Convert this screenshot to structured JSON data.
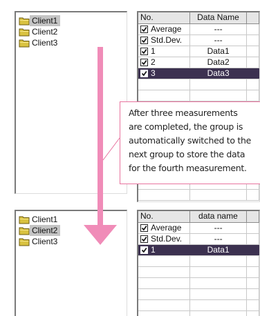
{
  "top": {
    "tree": [
      {
        "label": "Client1",
        "selected": true
      },
      {
        "label": "Client2",
        "selected": false
      },
      {
        "label": "Client3",
        "selected": false
      }
    ],
    "table": {
      "headers": [
        "No.",
        "Data Name",
        ""
      ],
      "rows": [
        {
          "no": "Average",
          "name": "---",
          "checked": true,
          "selected": false
        },
        {
          "no": "Std.Dev.",
          "name": "---",
          "checked": true,
          "selected": false
        },
        {
          "no": "1",
          "name": "Data1",
          "checked": true,
          "selected": false
        },
        {
          "no": "2",
          "name": "Data2",
          "checked": true,
          "selected": false
        },
        {
          "no": "3",
          "name": "Data3",
          "checked": true,
          "selected": true
        }
      ]
    }
  },
  "bottom": {
    "tree": [
      {
        "label": "Client1",
        "selected": false
      },
      {
        "label": "Client2",
        "selected": true
      },
      {
        "label": "Client3",
        "selected": false
      }
    ],
    "table": {
      "headers": [
        "No.",
        "data name",
        ""
      ],
      "rows": [
        {
          "no": "Average",
          "name": "---",
          "checked": true,
          "selected": false
        },
        {
          "no": "Std.Dev.",
          "name": "---",
          "checked": true,
          "selected": false
        },
        {
          "no": "1",
          "name": "Data1",
          "checked": true,
          "selected": true
        }
      ]
    }
  },
  "callout": {
    "lines": [
      "After three measurements",
      "are completed, the group is",
      "automatically switched to the",
      "next group to store the data",
      "for the fourth measurement."
    ]
  },
  "colors": {
    "arrow": "#f08cb8",
    "selection": "#3c3150",
    "folder": "#d9c240"
  },
  "icons": {
    "folder": "folder-icon",
    "checkbox": "checkbox-checked-icon",
    "arrow": "down-arrow-icon"
  }
}
